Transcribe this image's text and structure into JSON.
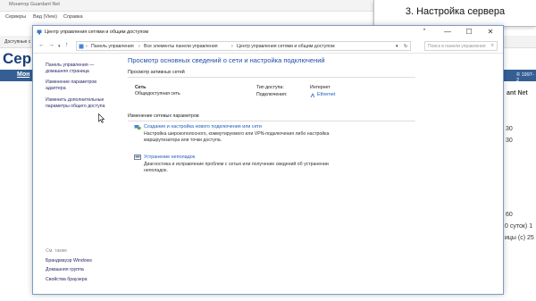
{
  "background_app": {
    "title": "Монитор Guardant Net",
    "menu": [
      "Серверы",
      "Вид (View)",
      "Справка"
    ],
    "toolbar_text": "Доступные с",
    "heading": "Серв",
    "nav_link": "Мон",
    "copyright": "© 1997-2",
    "right_text": [
      "ant Net",
      "30",
      "30",
      "60",
      "0 суток) 1",
      "ицы (с) 25"
    ]
  },
  "banner": {
    "text": "3. Настройка сервера"
  },
  "window": {
    "title": "Центр управления сетями и общим доступом",
    "controls": {
      "pin": "\"",
      "minimize": "—",
      "maximize": "☐",
      "close": "✕"
    },
    "breadcrumb": [
      "Панель управления",
      "Все элементы панели управления",
      "Центр управления сетями и общим доступом"
    ],
    "search_placeholder": "Поиск в панели управления",
    "left_pane": {
      "home": [
        "Панель управления —",
        "домашняя страница"
      ],
      "links": [
        [
          "Изменение параметров",
          "адаптера"
        ],
        [
          "Изменить дополнительные",
          "параметры общего доступа"
        ]
      ],
      "see_also_label": "См. также",
      "see_also": [
        "Брандмауэр Windows",
        "Домашняя группа",
        "Свойства браузера"
      ]
    },
    "main": {
      "title": "Просмотр основных сведений о сети и настройка подключений",
      "active_networks_label": "Просмотр активных сетей",
      "network_name": "Сеть",
      "network_type": "Общедоступная сеть",
      "access_type_label": "Тип доступа:",
      "access_type_value": "Интернет",
      "connections_label": "Подключения:",
      "connections_value": "Ethernet",
      "change_settings_label": "Изменение сетевых параметров",
      "items": [
        {
          "link": "Создание и настройка нового подключения или сети",
          "desc": [
            "Настройка широкополосного, коммутируемого или VPN-подключения либо настройка",
            "маршрутизатора или точки доступа."
          ]
        },
        {
          "link": "Устранение неполадок",
          "desc": [
            "Диагностика и исправление проблем с сетью или получение сведений об устранении",
            "неполадок."
          ]
        }
      ]
    }
  },
  "colors": {
    "link": "#1e5bb8",
    "title_blue": "#1e4fa8",
    "nav_bar": "#355f94"
  }
}
